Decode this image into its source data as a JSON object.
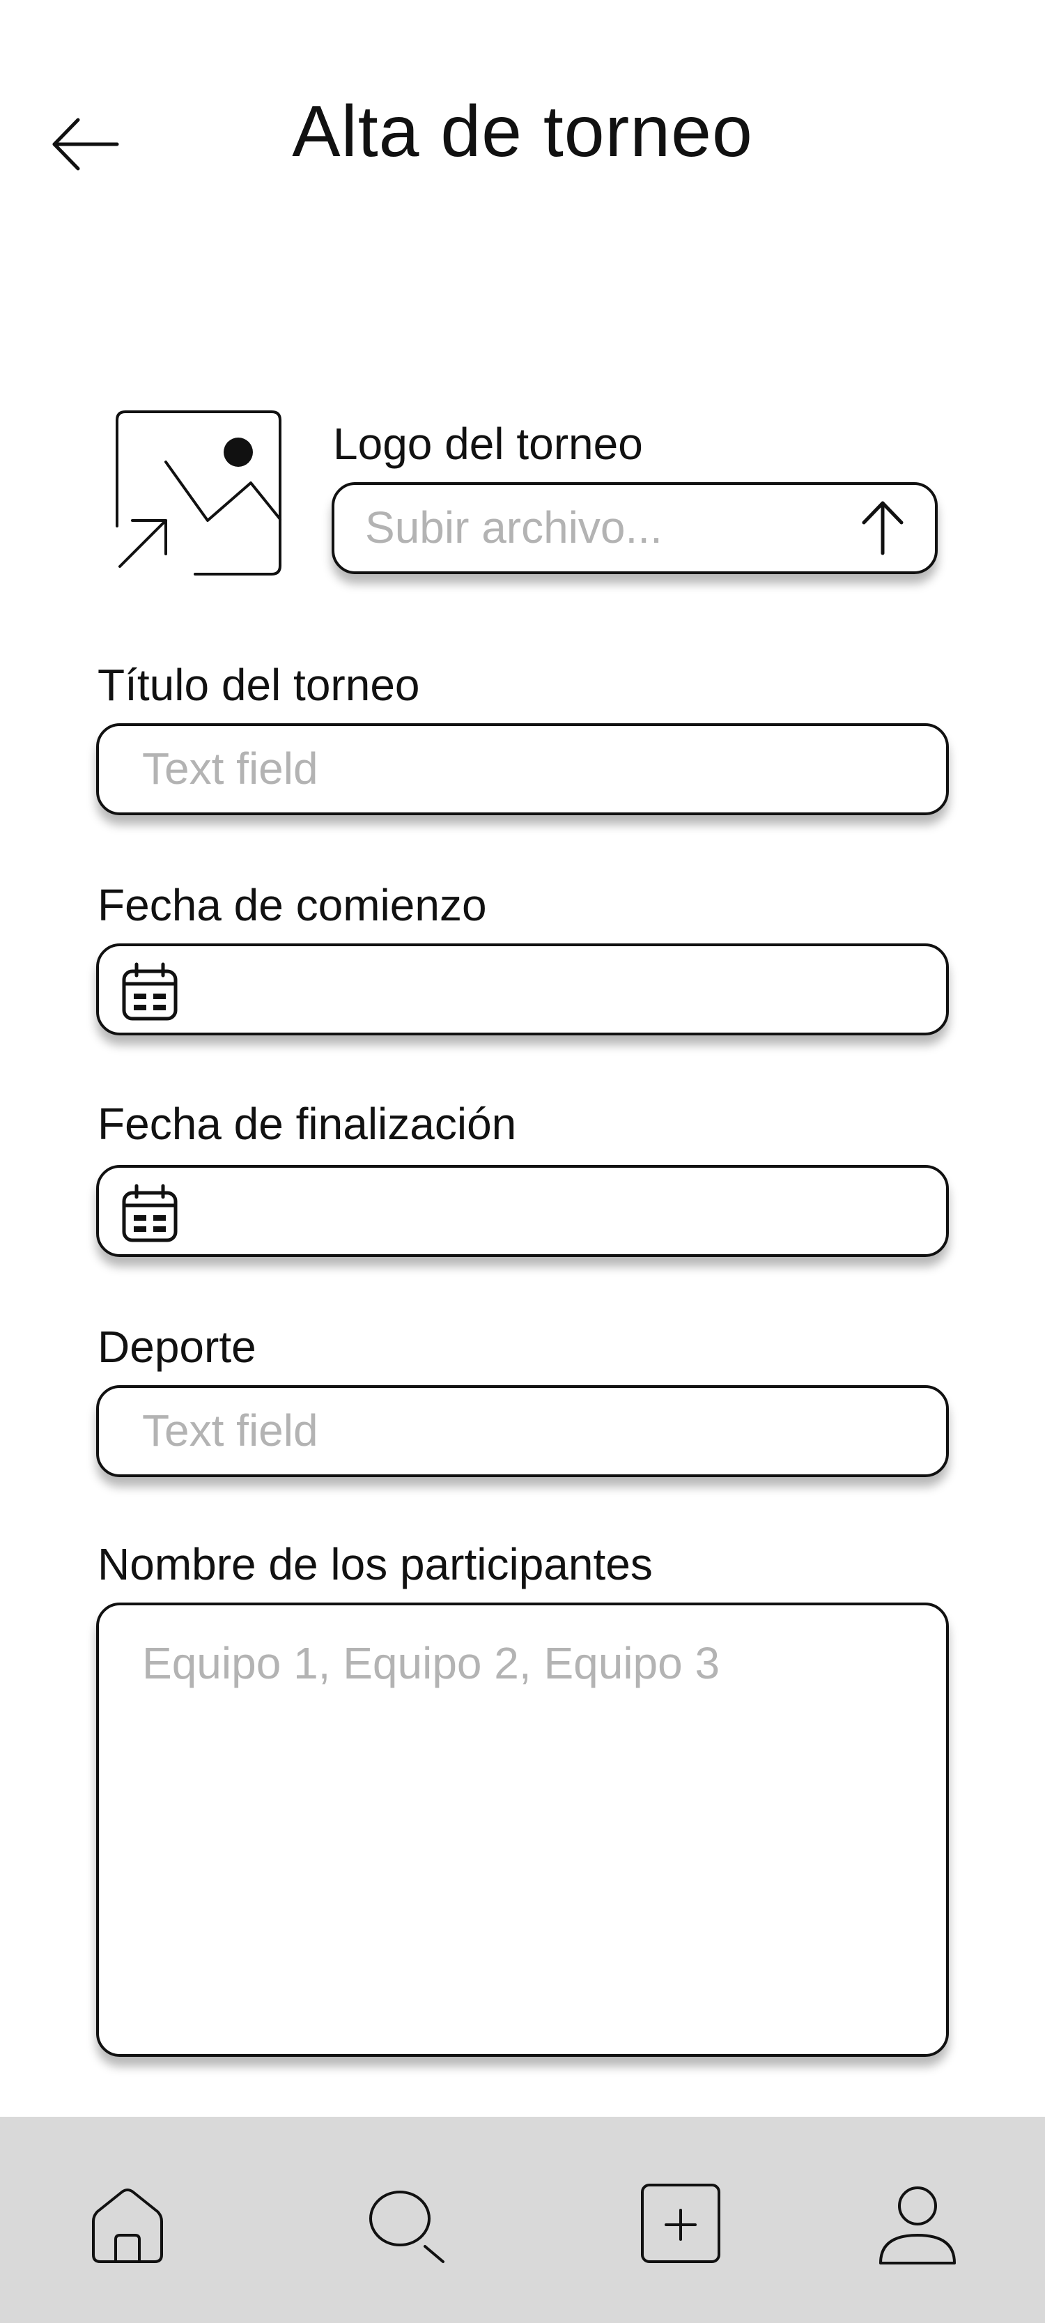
{
  "header": {
    "title": "Alta de torneo",
    "back_icon": "arrow-left-icon"
  },
  "form": {
    "logo": {
      "label": "Logo del torneo",
      "placeholder": "Subir archivo...",
      "upload_icon": "arrow-up-icon",
      "image_icon": "image-placeholder-icon"
    },
    "title": {
      "label": "Título del torneo",
      "placeholder": "Text field"
    },
    "start_date": {
      "label": "Fecha de comienzo",
      "icon": "calendar-icon"
    },
    "end_date": {
      "label": "Fecha de finalización",
      "icon": "calendar-icon"
    },
    "sport": {
      "label": "Deporte",
      "placeholder": "Text field"
    },
    "participants": {
      "label": "Nombre de los participantes",
      "placeholder": "Equipo 1, Equipo 2, Equipo 3"
    }
  },
  "bottom_nav": {
    "items": [
      {
        "icon": "home-icon"
      },
      {
        "icon": "search-icon"
      },
      {
        "icon": "add-square-icon"
      },
      {
        "icon": "profile-icon"
      }
    ]
  },
  "colors": {
    "nav_background": "#d9d9d9",
    "border": "#111111",
    "placeholder": "#b3b3b3"
  }
}
